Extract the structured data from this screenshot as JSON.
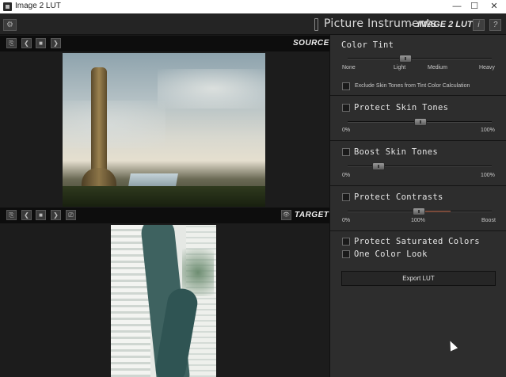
{
  "window": {
    "title": "Image 2 LUT",
    "controls": [
      "—",
      "☐",
      "✕"
    ]
  },
  "header": {
    "gear_icon": "⚙",
    "brand": "Picture Instruments",
    "brand_separator": "-",
    "product": "IMAGE 2 LUT",
    "info_label": "i",
    "help_label": "?"
  },
  "source_viewer": {
    "label": "SOURCE",
    "buttons": [
      "⎘",
      "❮",
      "■",
      "❯"
    ]
  },
  "target_viewer": {
    "label": "TARGET",
    "eye_icon": "👁",
    "buttons": [
      "⎘",
      "❮",
      "■",
      "❯",
      "⎚"
    ]
  },
  "panel": {
    "color_tint": {
      "title": "Color Tint",
      "level": "Light",
      "ticks": [
        "None",
        "Light",
        "Medium",
        "Heavy"
      ],
      "exclude_label": "Exclude Skin Tones from Tint Color Calculation"
    },
    "protect_skin": {
      "title": "Protect Skin Tones",
      "min": "0%",
      "max": "100%",
      "value_pct": 52
    },
    "boost_skin": {
      "title": "Boost Skin Tones",
      "min": "0%",
      "max": "100%",
      "value_pct": 22
    },
    "protect_contrasts": {
      "title": "Protect Contrasts",
      "min": "0%",
      "mid": "100%",
      "max": "Boost",
      "value_pct": 100
    },
    "protect_saturated": {
      "title": "Protect Saturated Colors"
    },
    "one_color_look": {
      "title": "One Color Look"
    },
    "export_label": "Export LUT"
  },
  "colors": {
    "panel_bg": "#2d2d2d",
    "toolbar_bg": "#0d0d0d",
    "header_bg": "#242424"
  }
}
